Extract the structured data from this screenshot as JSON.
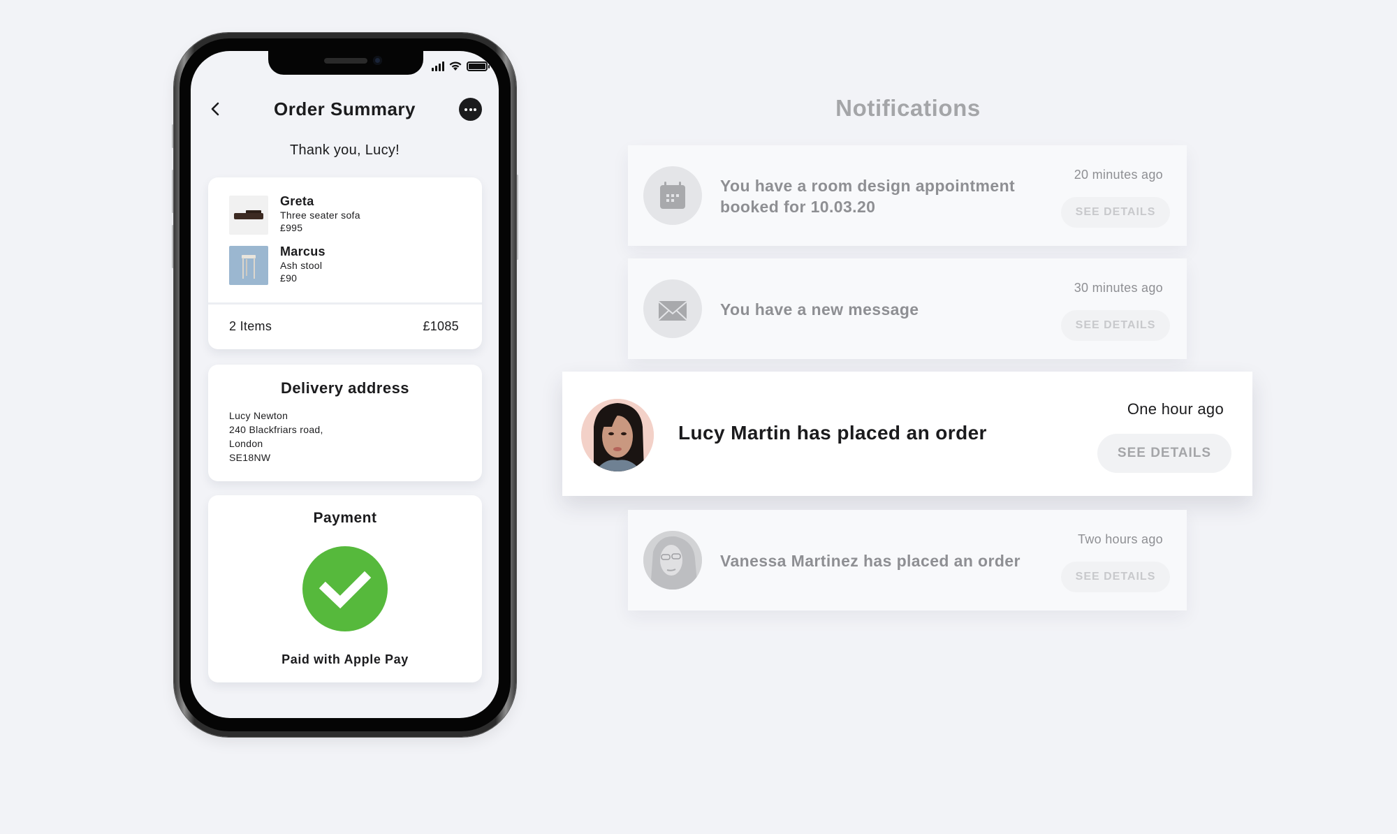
{
  "phone": {
    "status_bar": {
      "icons": [
        "signal-icon",
        "wifi-icon",
        "battery-icon"
      ]
    },
    "header": {
      "back_icon": "chevron-left-icon",
      "title": "Order Summary",
      "more_icon": "more-horizontal-icon"
    },
    "greeting": "Thank you, Lucy!",
    "order": {
      "items": [
        {
          "name": "Greta",
          "description": "Three seater sofa",
          "price": "£995",
          "image": "sofa-thumbnail"
        },
        {
          "name": "Marcus",
          "description": "Ash stool",
          "price": "£90",
          "image": "stool-thumbnail"
        }
      ],
      "count_label": "2 Items",
      "total": "£1085"
    },
    "delivery": {
      "title": "Delivery address",
      "lines": [
        "Lucy Newton",
        "240 Blackfriars road,",
        "London",
        "SE18NW"
      ]
    },
    "payment": {
      "title": "Payment",
      "status_icon": "check-circle-icon",
      "status_color": "#56b93c",
      "method_label": "Paid with Apple Pay"
    }
  },
  "notifications": {
    "title": "Notifications",
    "items": [
      {
        "icon": "calendar-icon",
        "message": "You have a room design appointment booked for 10.03.20",
        "message_lines": [
          "You have a room design appointment",
          "booked for 10.03.20"
        ],
        "time": "20 minutes ago",
        "action": "SEE DETAILS",
        "active": false
      },
      {
        "icon": "mail-icon",
        "message": "You have a new message",
        "time": "30 minutes ago",
        "action": "SEE DETAILS",
        "active": false
      },
      {
        "icon": "avatar-lucy-martin",
        "message": "Lucy Martin has placed an order",
        "time": "One hour ago",
        "action": "SEE DETAILS",
        "active": true
      },
      {
        "icon": "avatar-vanessa-martinez",
        "message": "Vanessa Martinez has placed an order",
        "time": "Two hours ago",
        "action": "SEE DETAILS",
        "active": false
      }
    ]
  }
}
